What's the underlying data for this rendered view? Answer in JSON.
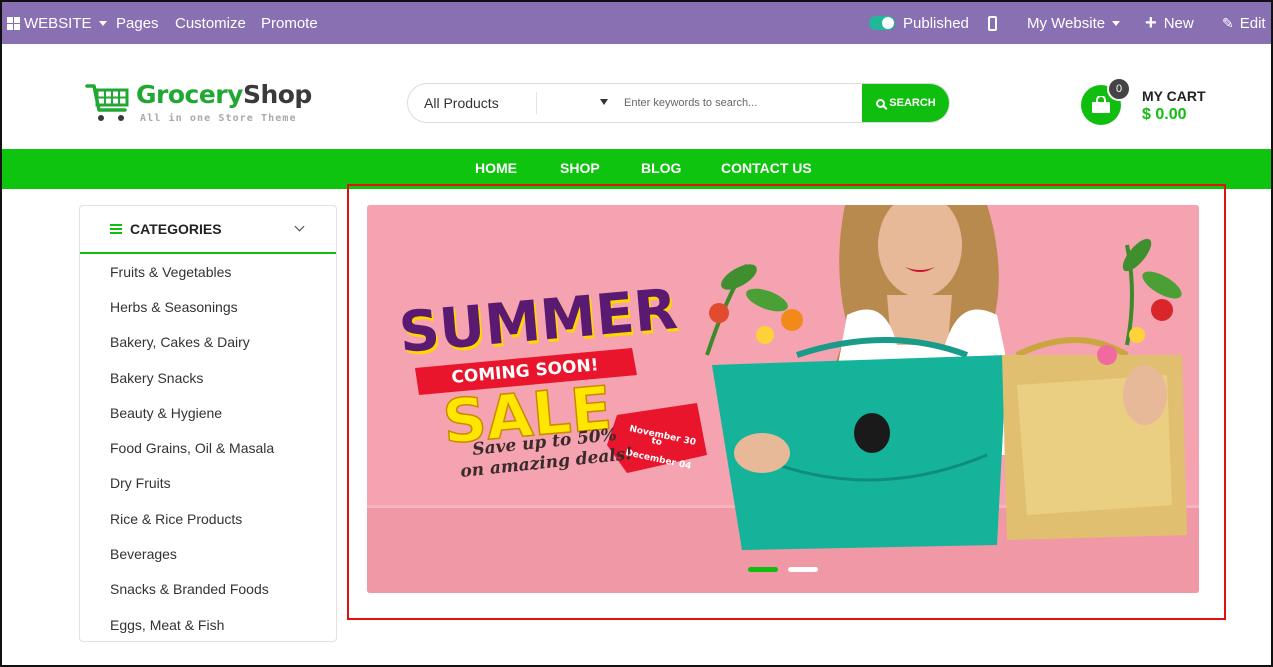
{
  "editor_bar": {
    "website_label": "WEBSITE",
    "menu": [
      "Pages",
      "Customize",
      "Promote"
    ],
    "published_label": "Published",
    "site_selector": "My Website",
    "new_label": "New",
    "edit_label": "Edit"
  },
  "logo": {
    "name_part1": "Grocery",
    "name_part2": "Shop",
    "tagline": "All in one Store Theme"
  },
  "search": {
    "category_selected": "All Products",
    "placeholder": "Enter keywords to search...",
    "button_label": "SEARCH"
  },
  "cart": {
    "count": "0",
    "label": "MY CART",
    "total": "$ 0.00"
  },
  "nav": {
    "items": [
      "HOME",
      "SHOP",
      "BLOG",
      "CONTACT US"
    ]
  },
  "sidebar": {
    "title": "CATEGORIES",
    "items": [
      "Fruits & Vegetables",
      "Herbs & Seasonings",
      "Bakery, Cakes & Dairy",
      "Bakery Snacks",
      "Beauty & Hygiene",
      "Food Grains, Oil & Masala",
      "Dry Fruits",
      "Rice & Rice Products",
      "Beverages",
      "Snacks & Branded Foods",
      "Eggs, Meat & Fish"
    ]
  },
  "banner": {
    "headline_1": "SUMMER",
    "ribbon": "COMING SOON!",
    "headline_2": "SALE",
    "tag_line_1": "November 30",
    "tag_line_2": "to",
    "tag_line_3": "December 04",
    "offer_line_1": "Save up to 50%",
    "offer_line_2": "on amazing deals!",
    "slide_count": 2,
    "active_slide": 1
  },
  "colors": {
    "editor_bar": "#8870b3",
    "brand_green": "#0fbe0f",
    "banner_pink": "#f5a3b0",
    "highlight_red": "#e01010"
  }
}
